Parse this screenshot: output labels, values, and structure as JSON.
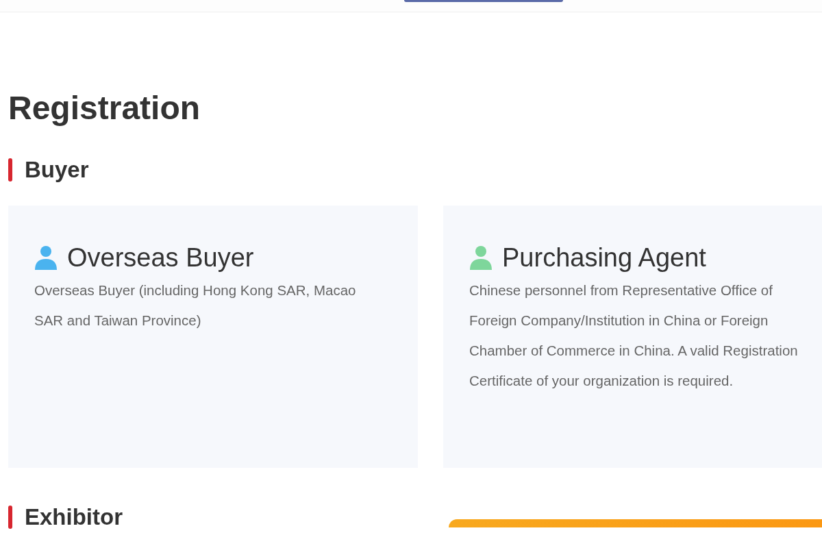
{
  "title": "Registration",
  "sections": [
    {
      "title": "Buyer",
      "cards": [
        {
          "title": "Overseas Buyer",
          "color": "#4ab3ef",
          "description": "Overseas Buyer (including Hong Kong SAR, Macao SAR and Taiwan Province)"
        },
        {
          "title": "Purchasing Agent",
          "color": "#7ed69b",
          "description": "Chinese personnel from Representative Office of Foreign Company/Institution in China or Foreign Chamber of Commerce in China. A valid Registration Certificate of your organization is required."
        }
      ]
    },
    {
      "title": "Exhibitor"
    }
  ]
}
